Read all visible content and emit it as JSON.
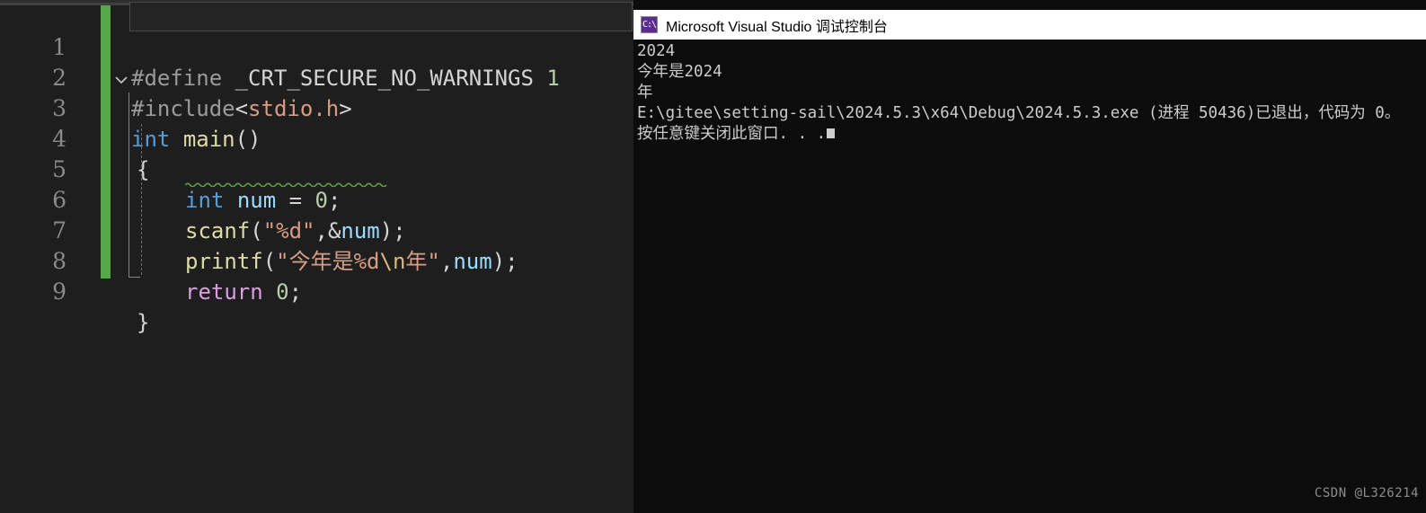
{
  "editor": {
    "change_bar_color": "#57a64a",
    "background": "#1e1e1e",
    "lines": [
      {
        "number": "1",
        "text": "#define _CRT_SECURE_NO_WARNINGS 1"
      },
      {
        "number": "2",
        "text": "#include<stdio.h>"
      },
      {
        "number": "3",
        "text": "int main()"
      },
      {
        "number": "4",
        "text": "{"
      },
      {
        "number": "5",
        "text": "    int num = 0;"
      },
      {
        "number": "6",
        "text": "    scanf(\"%d\",&num);"
      },
      {
        "number": "7",
        "text": "    printf(\"今年是%d\\n年\",num);"
      },
      {
        "number": "8",
        "text": "    return 0;"
      },
      {
        "number": "9",
        "text": "}"
      }
    ],
    "tokens": {
      "l1_define": "#define",
      "l1_macro": " _CRT_SECURE_NO_WARNINGS ",
      "l1_value": "1",
      "l2_include": "#include",
      "l2_lt": "<",
      "l2_header": "stdio.h",
      "l2_gt": ">",
      "l3_int": "int",
      "l3_space": " ",
      "l3_main": "main",
      "l3_parens": "()",
      "l4_brace": "{",
      "l5_int": "int",
      "l5_space": " ",
      "l5_num": "num",
      "l5_eq": " = ",
      "l5_zero": "0",
      "l5_semi": ";",
      "l6_scanf": "scanf",
      "l6_open": "(",
      "l6_str": "\"%d\"",
      "l6_comma": ",&",
      "l6_var": "num",
      "l6_close": ")",
      "l6_semi": ";",
      "l7_printf": "printf",
      "l7_open": "(",
      "l7_str1": "\"今年是%d",
      "l7_esc": "\\n",
      "l7_str2": "年\"",
      "l7_comma": ",",
      "l7_var": "num",
      "l7_close": ")",
      "l7_semi": ";",
      "l8_return": "return",
      "l8_space": " ",
      "l8_zero": "0",
      "l8_semi": ";",
      "l9_brace": "}"
    }
  },
  "console": {
    "title": "Microsoft Visual Studio 调试控制台",
    "icon_label": "C:\\",
    "background": "#0c0c0c",
    "titlebar_background": "#ffffff",
    "output": [
      "2024",
      "今年是2024",
      "年",
      "E:\\gitee\\setting-sail\\2024.5.3\\x64\\Debug\\2024.5.3.exe (进程 50436)已退出，代码为 0。",
      "按任意键关闭此窗口. . ."
    ]
  },
  "watermark": {
    "text": "CSDN @L326214"
  }
}
